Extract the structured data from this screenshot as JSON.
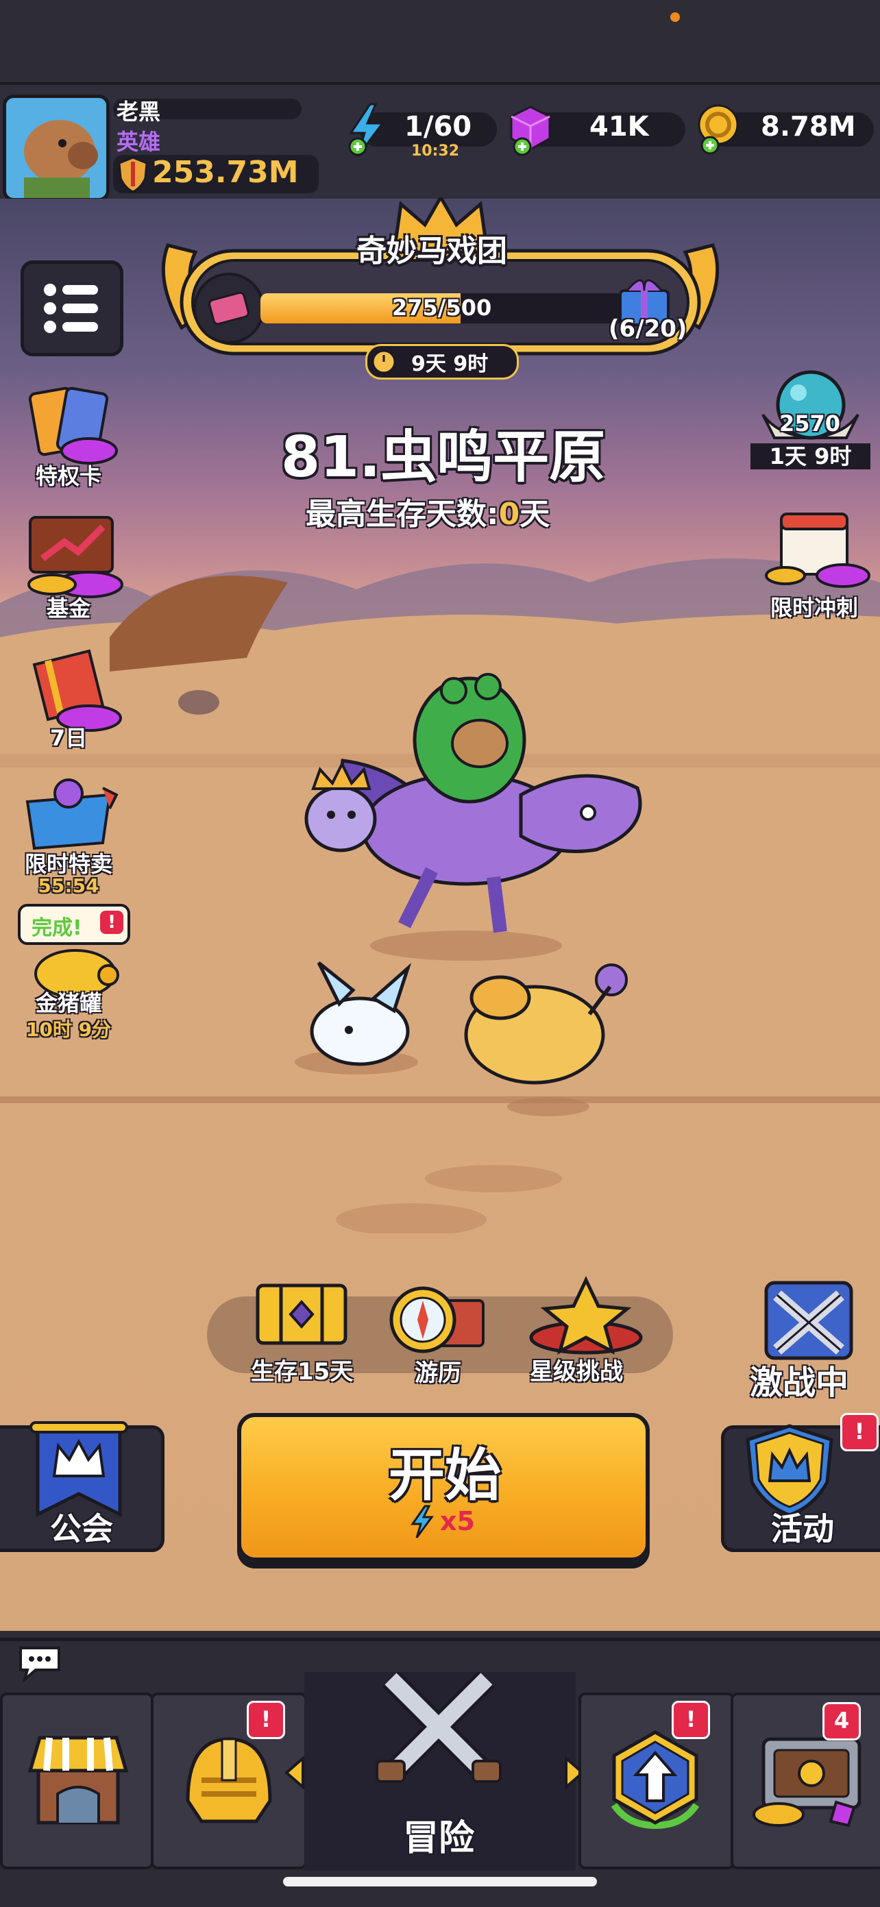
{
  "player": {
    "name": "老黑",
    "rank": "英雄",
    "power": "253.73M"
  },
  "resources": {
    "energy": "1/60",
    "energy_timer": "10:32",
    "gems": "41K",
    "gold": "8.78M"
  },
  "event": {
    "title": "奇妙马戏团",
    "progress_text": "275/500",
    "progress_fraction": 0.55,
    "reward_count": "(6/20)",
    "timer": "9天 9时"
  },
  "stage": {
    "title": "81.虫鸣平原",
    "best_label": "最高生存天数:",
    "best_value": "0",
    "best_unit": "天"
  },
  "left_menu": [
    {
      "label": "特权卡",
      "icon": "privilege-card-icon"
    },
    {
      "label": "基金",
      "icon": "fund-chart-icon"
    },
    {
      "label": "7日",
      "icon": "gift-bag-icon"
    },
    {
      "label": "限时特卖",
      "sub": "55:54",
      "icon": "sale-basket-icon"
    },
    {
      "label": "金猪罐",
      "sub": "10时 9分",
      "icon": "piggy-bank-icon",
      "bubble": "完成!"
    }
  ],
  "right_menu": {
    "orb_value": "2570",
    "orb_timer": "1天 9时",
    "sprint_label": "限时冲刺"
  },
  "quick_actions": [
    {
      "label": "生存15天",
      "icon": "treasure-chest-icon"
    },
    {
      "label": "游历",
      "icon": "compass-icon"
    },
    {
      "label": "星级挑战",
      "icon": "star-pedestal-icon"
    }
  ],
  "battle_status": "激战中",
  "guild_label": "公会",
  "start": {
    "label": "开始",
    "cost": "x5"
  },
  "activity_label": "活动",
  "nav": {
    "active_label": "冒险",
    "chest_badge": "4"
  },
  "colors": {
    "accent_gold": "#f5a623",
    "badge_red": "#e3284a",
    "gem_purple": "#c23ce6"
  }
}
